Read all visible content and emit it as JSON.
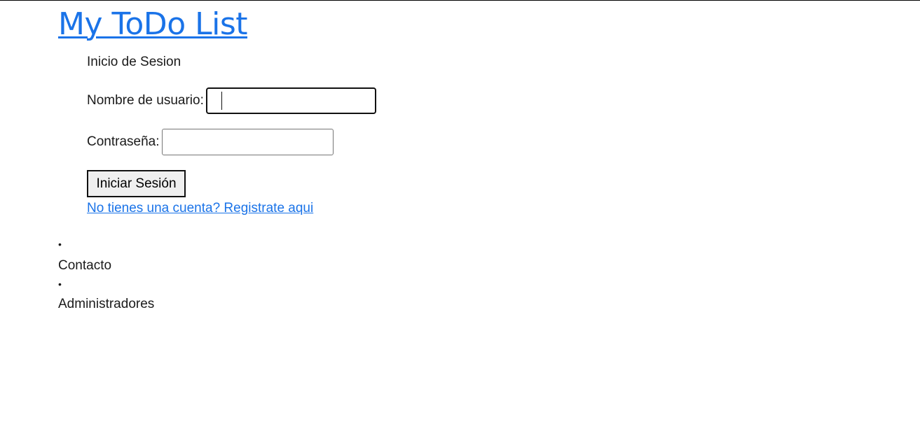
{
  "header": {
    "title": "My ToDo List"
  },
  "login_form": {
    "heading": "Inicio de Sesion",
    "username_label": "Nombre de usuario:",
    "username_value": "",
    "password_label": "Contraseña:",
    "password_value": "",
    "submit_label": "Iniciar Sesión",
    "register_link": "No tienes una cuenta? Registrate aqui"
  },
  "footer": {
    "items": [
      {
        "label": "Contacto"
      },
      {
        "label": "Administradores"
      }
    ]
  },
  "colors": {
    "link": "#1a73e8",
    "text": "#1a1a1a",
    "button_bg": "#efefef"
  },
  "icons": {
    "list_bullet": "•"
  }
}
